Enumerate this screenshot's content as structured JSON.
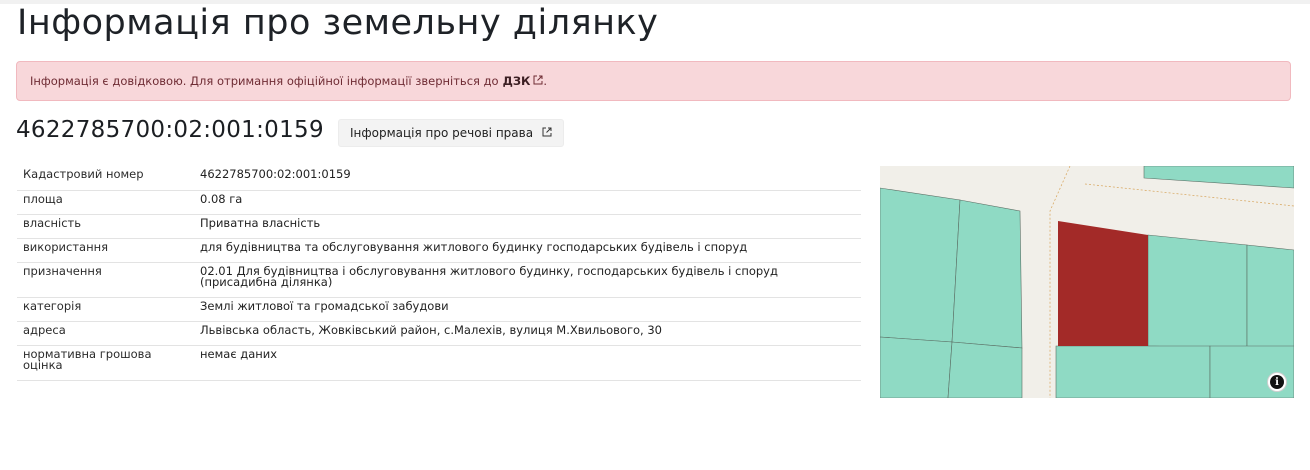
{
  "page": {
    "title": "Інформація про земельну ділянку"
  },
  "notice": {
    "text": "Інформація є довідковою. Для отримання офіційної інформації зверніться до",
    "link_label": "ДЗК",
    "suffix": ".",
    "background_color": "#f8d7da"
  },
  "parcel": {
    "cadastral_number": "4622785700:02:001:0159",
    "rights_button_label": "Інформація про речові права"
  },
  "details": [
    {
      "label": "Кадастровий номер",
      "value": "4622785700:02:001:0159"
    },
    {
      "label": "площа",
      "value": "0.08 га"
    },
    {
      "label": "власність",
      "value": "Приватна власність"
    },
    {
      "label": "використання",
      "value": "для будівництва та обслуговування житлового будинку господарських будівель і споруд"
    },
    {
      "label": "призначення",
      "value": "02.01 Для будівництва і обслуговування житлового будинку, господарських будівель і споруд (присадибна ділянка)"
    },
    {
      "label": "категорія",
      "value": "Землі житлової та громадської забудови"
    },
    {
      "label": "адреса",
      "value": "Львівська область, Жовківський район, с.Малехів, вулиця М.Хвильового, 30"
    },
    {
      "label": "нормативна грошова оцінка",
      "value": "немає даних"
    }
  ],
  "map": {
    "parcel_color": "#a32a28",
    "neighbour_color": "#8fdac4",
    "road_color": "#f1efe9",
    "info_icon": "info-icon",
    "info_symbol": "i"
  },
  "icons": {
    "external": "↗"
  }
}
